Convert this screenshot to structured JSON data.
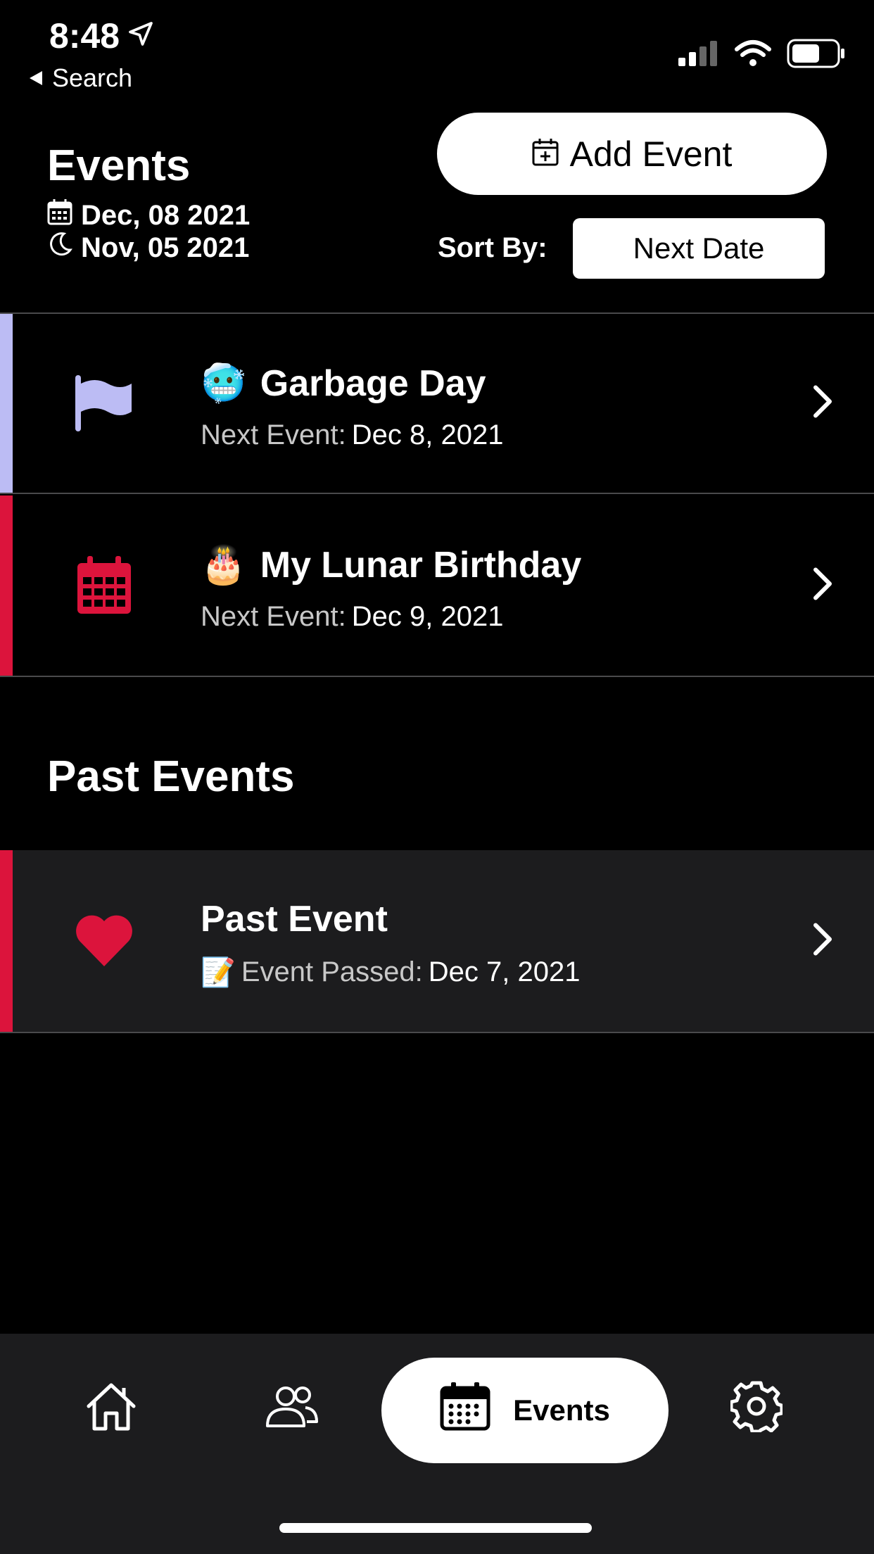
{
  "status_bar": {
    "time": "8:48",
    "back_label": "Search"
  },
  "header": {
    "title": "Events",
    "solar_date": "Dec, 08 2021",
    "lunar_date": "Nov, 05 2021",
    "add_event_label": "Add Event",
    "sort_label": "Sort By:",
    "sort_value": "Next Date"
  },
  "events": [
    {
      "title": "Garbage Day",
      "emoji": "🥶",
      "sub_label": "Next Event:",
      "sub_value": "Dec 8, 2021",
      "icon": "flag-icon",
      "accent": "#BCBCF4"
    },
    {
      "title": "My Lunar Birthday",
      "emoji": "🎂",
      "sub_label": "Next Event:",
      "sub_value": "Dec 9, 2021",
      "icon": "calendar-icon",
      "accent": "#DC143C"
    }
  ],
  "past_section": {
    "title": "Past Events",
    "events": [
      {
        "title": "Past Event",
        "emoji": "📝",
        "sub_label": "Event Passed:",
        "sub_value": "Dec 7, 2021",
        "icon": "heart-icon",
        "accent": "#DC143C"
      }
    ]
  },
  "tabbar": {
    "items": [
      {
        "name": "home",
        "icon": "home-icon"
      },
      {
        "name": "people",
        "icon": "people-icon"
      },
      {
        "name": "events",
        "icon": "calendar-icon",
        "label": "Events",
        "active": true
      },
      {
        "name": "settings",
        "icon": "gear-icon"
      }
    ]
  }
}
